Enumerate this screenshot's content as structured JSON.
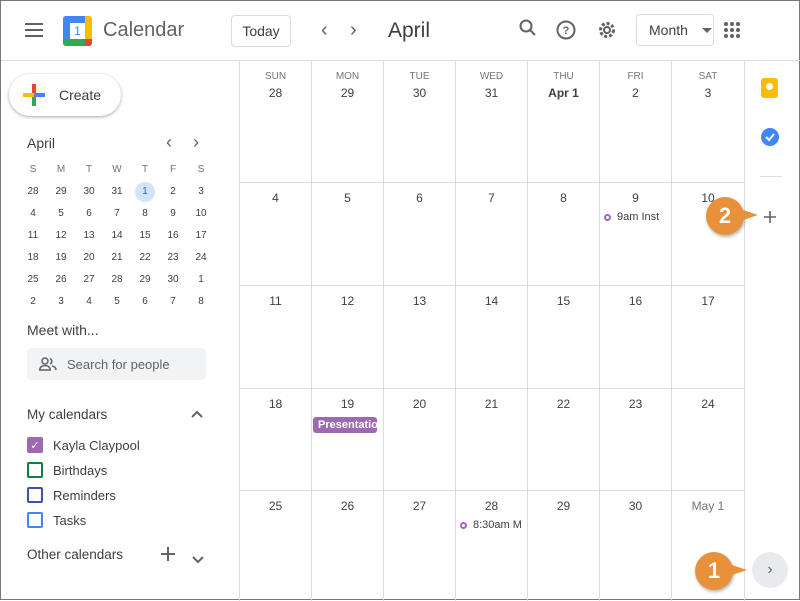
{
  "header": {
    "app_title": "Calendar",
    "logo_number": "1",
    "today": "Today",
    "prev": "‹",
    "next": "›",
    "period": "April",
    "view": "Month"
  },
  "sidebar": {
    "create": "Create",
    "mini": {
      "title": "April",
      "prev": "‹",
      "next": "›",
      "weekdays": [
        "S",
        "M",
        "T",
        "W",
        "T",
        "F",
        "S"
      ],
      "weeks": [
        [
          "28",
          "29",
          "30",
          "31",
          "1",
          "2",
          "3"
        ],
        [
          "4",
          "5",
          "6",
          "7",
          "8",
          "9",
          "10"
        ],
        [
          "11",
          "12",
          "13",
          "14",
          "15",
          "16",
          "17"
        ],
        [
          "18",
          "19",
          "20",
          "21",
          "22",
          "23",
          "24"
        ],
        [
          "25",
          "26",
          "27",
          "28",
          "29",
          "30",
          "1"
        ],
        [
          "2",
          "3",
          "4",
          "5",
          "6",
          "7",
          "8"
        ]
      ],
      "selected": "1"
    },
    "meet_title": "Meet with...",
    "search_placeholder": "Search for people",
    "my_calendars": "My calendars",
    "calendars": [
      {
        "label": "Kayla Claypool",
        "color": "#9e69af",
        "checked": true
      },
      {
        "label": "Birthdays",
        "color": "#0b8043",
        "checked": false
      },
      {
        "label": "Reminders",
        "color": "#3f51b5",
        "checked": false
      },
      {
        "label": "Tasks",
        "color": "#4285f4",
        "checked": false
      }
    ],
    "other_calendars": "Other calendars"
  },
  "grid": {
    "weekdays": [
      "SUN",
      "MON",
      "TUE",
      "WED",
      "THU",
      "FRI",
      "SAT"
    ],
    "weeks": [
      [
        {
          "d": "28"
        },
        {
          "d": "29"
        },
        {
          "d": "30"
        },
        {
          "d": "31"
        },
        {
          "d": "Apr 1",
          "bold": true
        },
        {
          "d": "2"
        },
        {
          "d": "3"
        }
      ],
      [
        {
          "d": "4"
        },
        {
          "d": "5"
        },
        {
          "d": "6"
        },
        {
          "d": "7"
        },
        {
          "d": "8"
        },
        {
          "d": "9",
          "event": {
            "type": "dot",
            "text": "9am Inst"
          }
        },
        {
          "d": "10"
        }
      ],
      [
        {
          "d": "11"
        },
        {
          "d": "12"
        },
        {
          "d": "13"
        },
        {
          "d": "14"
        },
        {
          "d": "15"
        },
        {
          "d": "16"
        },
        {
          "d": "17"
        }
      ],
      [
        {
          "d": "18"
        },
        {
          "d": "19",
          "event": {
            "type": "bar",
            "text": "Presentatio"
          }
        },
        {
          "d": "20"
        },
        {
          "d": "21"
        },
        {
          "d": "22"
        },
        {
          "d": "23"
        },
        {
          "d": "24"
        }
      ],
      [
        {
          "d": "25"
        },
        {
          "d": "26"
        },
        {
          "d": "27"
        },
        {
          "d": "28",
          "event": {
            "type": "dot",
            "text": "8:30am M"
          }
        },
        {
          "d": "29"
        },
        {
          "d": "30"
        },
        {
          "d": "May 1",
          "dim": true
        }
      ]
    ]
  },
  "side_panel": {
    "icons": [
      "keep-icon",
      "tasks-icon",
      "add-addon-icon"
    ],
    "expand": "›"
  },
  "callouts": [
    "1",
    "2"
  ],
  "colors": {
    "event": "#9e69af",
    "callout": "#e8903a",
    "accent": "#1a73e8"
  }
}
